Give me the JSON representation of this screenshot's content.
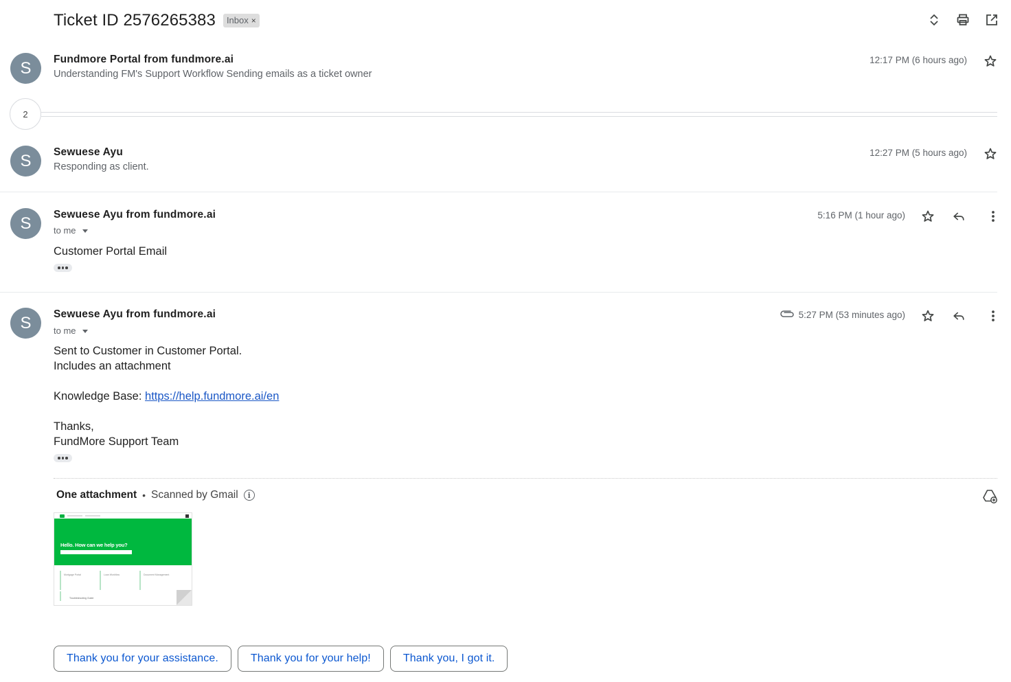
{
  "thread": {
    "subject": "Ticket ID 2576265383",
    "label": "Inbox",
    "label_remove": "×"
  },
  "top_actions": {
    "icons": [
      "expand-collapse-icon",
      "print-icon",
      "open-new-window-icon"
    ]
  },
  "messages": [
    {
      "avatar": "S",
      "sender": "Fundmore Portal from fundmore.ai",
      "snippet": "Understanding FM's Support Workflow Sending emails as a ticket owner",
      "time": "12:17 PM (6 hours ago)"
    },
    {
      "collapsed_count": "2"
    },
    {
      "avatar": "S",
      "sender": "Sewuese Ayu",
      "snippet": "Responding as client.",
      "time": "12:27 PM (5 hours ago)"
    },
    {
      "avatar": "S",
      "sender": "Sewuese Ayu from fundmore.ai",
      "recipient": "to me",
      "time": "5:16 PM (1 hour ago)",
      "body": "Customer Portal Email"
    },
    {
      "avatar": "S",
      "sender": "Sewuese Ayu from fundmore.ai",
      "recipient": "to me",
      "time": "5:27 PM (53 minutes ago)",
      "body_lines": [
        "Sent to Customer in Customer Portal.",
        "Includes an attachment"
      ],
      "kb_label": "Knowledge Base: ",
      "kb_link": "https://help.fundmore.ai/en",
      "signoff": "Thanks,",
      "signature": "FundMore Support Team"
    }
  ],
  "attachments": {
    "heading": "One attachment",
    "separator": "•",
    "scan_note": "Scanned by Gmail",
    "info_glyph": "i",
    "thumbnail": {
      "hero_text": "Hello. How can we help you?",
      "cards": [
        "Mortgage Portal",
        "Loan Workflow",
        "Document Management"
      ],
      "lower": "Troubleshooting Guide"
    }
  },
  "smart_replies": [
    "Thank you for your assistance.",
    "Thank you for your help!",
    "Thank you, I got it."
  ],
  "colors": {
    "avatar_bg": "#7b8d9b",
    "link": "#1a57c6",
    "smart_reply_text": "#0b57d0",
    "thumbnail_green": "#00b83f"
  }
}
